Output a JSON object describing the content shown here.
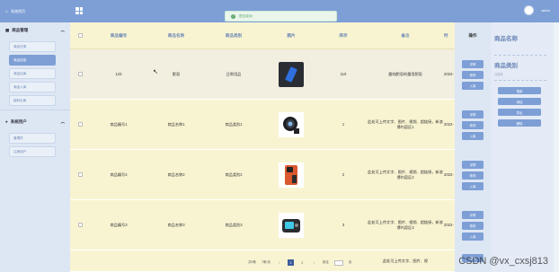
{
  "sidebar": {
    "home_label": "系统首页",
    "groups": [
      {
        "title": "商品管理",
        "items": [
          {
            "label": "商品分类"
          },
          {
            "label": "商品信息",
            "active": true
          },
          {
            "label": "商品出库"
          },
          {
            "label": "商品入库"
          },
          {
            "label": "缺料出库"
          }
        ]
      },
      {
        "title": "系统用户",
        "items": [
          {
            "label": "管理员"
          },
          {
            "label": "注册用户"
          }
        ]
      }
    ]
  },
  "topbar": {
    "title": "",
    "admin": "admin"
  },
  "toast": {
    "text": "提交成功!"
  },
  "table": {
    "headers": [
      "商品编号",
      "商品名称",
      "商品类别",
      "图片",
      "库存",
      "备注",
      "时"
    ],
    "rows": [
      {
        "no": "123",
        "name": "肥皂",
        "type": "日常用品",
        "stock": "110",
        "note": "量纯肥皂的量用肥皂",
        "time": "2022-",
        "thumb": "phone-blue"
      },
      {
        "no": "商品编号1",
        "name": "商品名称1",
        "type": "商品类别1",
        "stock": "1",
        "note": "此处可上传文字、图片、视频、超链接，新浪博内容区1",
        "time": "2022-",
        "thumb": "camera"
      },
      {
        "no": "商品编号2",
        "name": "商品名称2",
        "type": "商品类别2",
        "stock": "2",
        "note": "此处可上传文字、图片、视频、超链接，新浪博内容区2",
        "time": "2022-",
        "thumb": "phone-orange"
      },
      {
        "no": "商品编号3",
        "name": "商品名称3",
        "type": "商品类别3",
        "stock": "3",
        "note": "此处可上传文字、图片、视频、超链接，新浪博内容区3",
        "time": "2022-",
        "thumb": "console"
      },
      {
        "no": "",
        "name": "",
        "type": "",
        "stock": "",
        "note": "此处可上传文字、图片、视",
        "time": "",
        "thumb": ""
      }
    ]
  },
  "ops": {
    "header": "操作",
    "buttons": [
      "详情",
      "修改",
      "入库"
    ]
  },
  "panel": {
    "name_label": "商品名称",
    "type_label": "商品类别",
    "type_placeholder": "请选择",
    "buttons": [
      "搜索",
      "添加",
      "导出",
      "删除"
    ]
  },
  "pager": {
    "total": "共5条",
    "size": "7条/页",
    "pages": [
      "1",
      "2"
    ],
    "goto": "前往",
    "page_unit": "页"
  },
  "watermark": "CSDN @vx_cxsj813",
  "colors": {
    "accent": "#7d9fd6",
    "table_bg": "#f8f4d2",
    "title": "#e8d46a"
  }
}
